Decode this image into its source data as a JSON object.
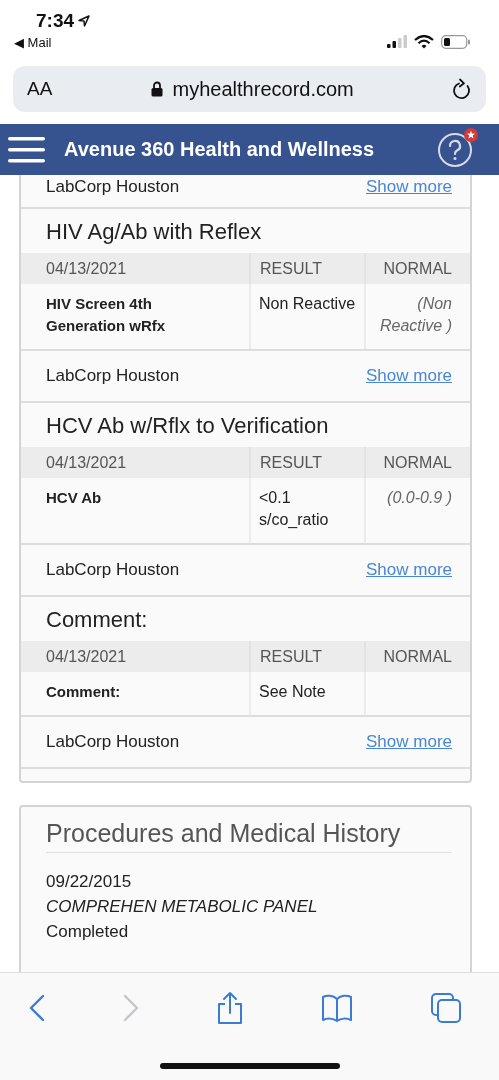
{
  "status_bar": {
    "time": "7:34",
    "back_label": "◀ Mail"
  },
  "address_bar": {
    "text_size_label": "AA",
    "url": "myhealthrecord.com"
  },
  "header": {
    "title": "Avenue 360 Health and Wellness",
    "help_badge": true
  },
  "lab_results": [
    {
      "lab": "LabCorp Houston",
      "link": "Show more"
    },
    {
      "title": "HIV Ag/Ab with Reflex",
      "columns": [
        "04/13/2021",
        "RESULT",
        "NORMAL"
      ],
      "rows": [
        {
          "test": "HIV Screen 4th Generation wRfx",
          "result": "Non Reactive",
          "normal": "(Non Reactive )"
        }
      ],
      "lab": "LabCorp Houston",
      "link": "Show more"
    },
    {
      "title": "HCV Ab w/Rflx to Verification",
      "columns": [
        "04/13/2021",
        "RESULT",
        "NORMAL"
      ],
      "rows": [
        {
          "test": "HCV Ab",
          "result": "<0.1 s/co_ratio",
          "normal": "(0.0-0.9 )"
        }
      ],
      "lab": "LabCorp Houston",
      "link": "Show more"
    },
    {
      "title": "Comment:",
      "columns": [
        "04/13/2021",
        "RESULT",
        "NORMAL"
      ],
      "rows": [
        {
          "test": "Comment:",
          "result": "See Note",
          "normal": ""
        }
      ],
      "lab": "LabCorp Houston",
      "link": "Show more"
    }
  ],
  "procedures": {
    "title": "Procedures and Medical History",
    "items": [
      {
        "date": "09/22/2015",
        "name": "COMPREHEN METABOLIC PANEL",
        "status": "Completed"
      }
    ]
  },
  "toolbar": [
    {
      "kind": "back",
      "disabled": false
    },
    {
      "kind": "forward",
      "disabled": true
    },
    {
      "kind": "share",
      "disabled": false
    },
    {
      "kind": "bookmarks",
      "disabled": false
    },
    {
      "kind": "tabs",
      "disabled": false
    }
  ]
}
